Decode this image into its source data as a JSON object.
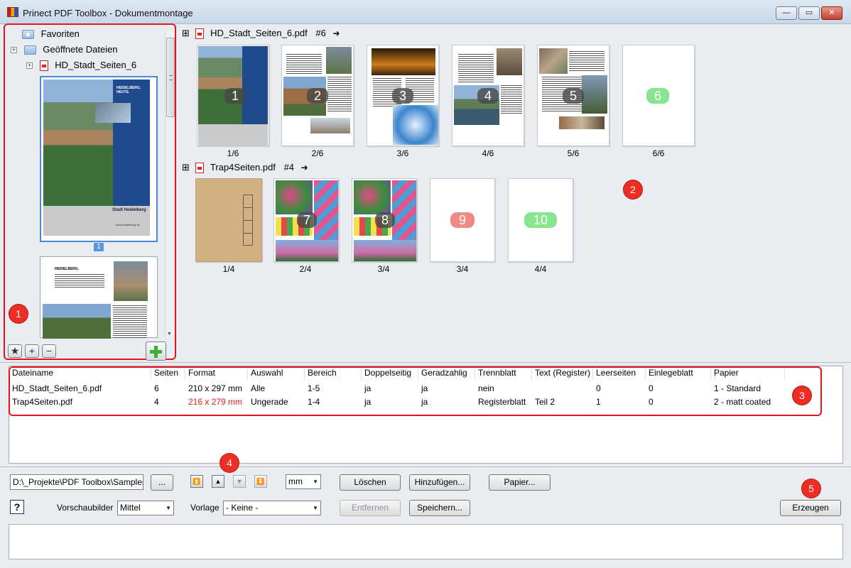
{
  "window": {
    "title": "Prinect PDF Toolbox - Dokumentmontage",
    "minimize_glyph": "—",
    "maximize_glyph": "▭",
    "close_glyph": "✕"
  },
  "sidebar": {
    "tree": [
      {
        "label": "Favoriten",
        "icon": "favorites-folder-icon"
      },
      {
        "label": "Geöffnete Dateien",
        "icon": "folder-icon"
      },
      {
        "label": "HD_Stadt_Seiten_6",
        "icon": "pdf-icon"
      }
    ],
    "thumb1_badge": "1",
    "thumb1_title": "HEIDELBERG. HEUTE.",
    "thumb1_logo": "Stadt Heidelberg",
    "thumb1_url": "www.heidelberg.de",
    "thumb2_heading": "HEIDELBERG.",
    "buttons": {
      "favorite": "★",
      "add": "+",
      "remove": "−"
    }
  },
  "callouts": [
    "1",
    "2",
    "3",
    "4",
    "5"
  ],
  "preview": {
    "doc1": {
      "name": "HD_Stadt_Seiten_6.pdf",
      "count": "#6",
      "expander": "⊞",
      "arrow": "➜",
      "pages": [
        {
          "num": "1",
          "label": "1/6"
        },
        {
          "num": "2",
          "label": "2/6"
        },
        {
          "num": "3",
          "label": "3/6"
        },
        {
          "num": "4",
          "label": "4/6"
        },
        {
          "num": "5",
          "label": "5/6"
        },
        {
          "num": "6",
          "label": "6/6"
        }
      ]
    },
    "doc2": {
      "name": "Trap4Seiten.pdf",
      "count": "#4",
      "expander": "⊞",
      "arrow": "➜",
      "pages": [
        {
          "num": "",
          "label": "1/4"
        },
        {
          "num": "7",
          "label": "2/4"
        },
        {
          "num": "8",
          "label": "3/4"
        },
        {
          "num": "9",
          "label": "4/4"
        },
        {
          "num": "10",
          "label": ""
        }
      ]
    }
  },
  "table": {
    "headers": [
      "Dateiname",
      "Seiten",
      "Format",
      "Auswahl",
      "Bereich",
      "Doppelseitig",
      "Geradzahlig",
      "Trennblatt",
      "Text (Register)",
      "Leerseiten",
      "Einlegeblatt",
      "Papier"
    ],
    "rows": [
      [
        "HD_Stadt_Seiten_6.pdf",
        "6",
        "210 x 297 mm",
        "Alle",
        "1-5",
        "ja",
        "ja",
        "nein",
        "",
        "0",
        "0",
        "1 - Standard"
      ],
      [
        "Trap4Seiten.pdf",
        "4",
        "216 x 279 mm",
        "Ungerade",
        "1-4",
        "ja",
        "ja",
        "Registerblatt",
        "Teil 2",
        "1",
        "0",
        "2 - matt coated"
      ]
    ]
  },
  "controls": {
    "path_value": "D:\\_Projekte\\PDF Toolbox\\Samples\\Tra",
    "browse_label": "...",
    "nav": {
      "top": "⏫",
      "up": "▲",
      "down": "▼",
      "bottom": "⏬"
    },
    "unit_value": "mm",
    "delete_label": "Löschen",
    "add_label": "Hinzufügen...",
    "paper_label": "Papier...",
    "help_label": "?",
    "preview_label": "Vorschaubilder",
    "preview_value": "Mittel",
    "template_label": "Vorlage",
    "template_value": "- Keine -",
    "remove_label": "Entfernen",
    "save_label": "Speichern...",
    "generate_label": "Erzeugen"
  },
  "colors": {
    "highlight": "#e3141b",
    "callout": "#ee2d24",
    "green_badge": "#86e58e",
    "red_badge": "#f08a84",
    "format_warning": "#e0201a"
  }
}
